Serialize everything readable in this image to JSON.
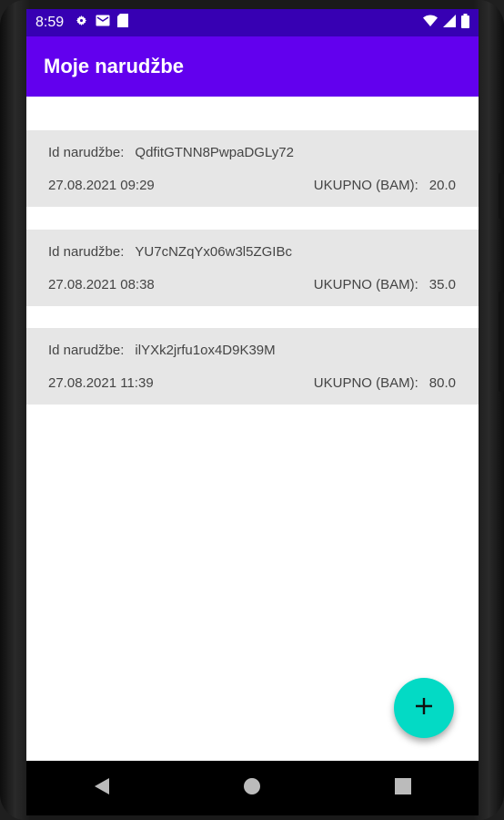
{
  "status_bar": {
    "time": "8:59",
    "icons_left": [
      "settings-icon",
      "mail-icon",
      "sd-card-icon"
    ],
    "icons_right": [
      "wifi-icon",
      "signal-icon",
      "battery-icon"
    ]
  },
  "app_bar": {
    "title": "Moje narudžbe"
  },
  "orders": [
    {
      "id_label": "Id narudžbe:",
      "id": "QdfitGTNN8PwpaDGLy72",
      "date": "27.08.2021 09:29",
      "total_label": "UKUPNO (BAM):",
      "total": "20.0"
    },
    {
      "id_label": "Id narudžbe:",
      "id": "YU7cNZqYx06w3l5ZGIBc",
      "date": "27.08.2021 08:38",
      "total_label": "UKUPNO (BAM):",
      "total": "35.0"
    },
    {
      "id_label": "Id narudžbe:",
      "id": "ilYXk2jrfu1ox4D9K39M",
      "date": "27.08.2021 11:39",
      "total_label": "UKUPNO (BAM):",
      "total": "80.0"
    }
  ],
  "fab": {
    "icon": "plus-icon"
  },
  "nav_bar": {
    "buttons": [
      "back-icon",
      "home-icon",
      "recents-icon"
    ]
  },
  "colors": {
    "status_bar": "#3700b3",
    "app_bar": "#6200ee",
    "fab": "#03dac5",
    "card": "#e6e6e6"
  }
}
